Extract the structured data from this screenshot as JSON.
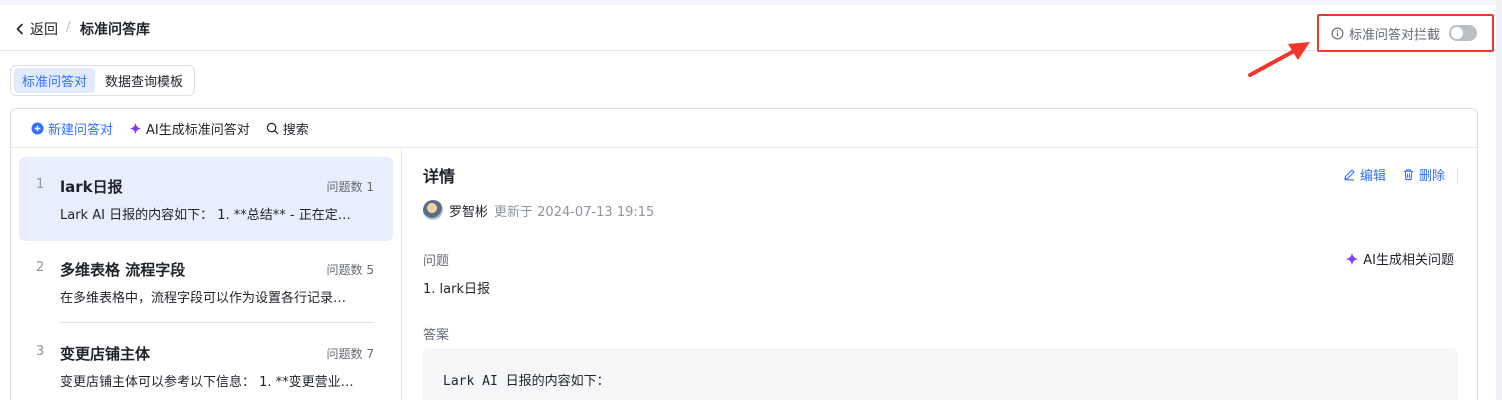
{
  "header": {
    "back_label": "返回",
    "separator": "/",
    "breadcrumb_title": "标准问答库",
    "intercept_label": "标准问答对拦截",
    "intercept_enabled": false
  },
  "tabs": [
    {
      "label": "标准问答对",
      "active": true
    },
    {
      "label": "数据查询模板",
      "active": false
    }
  ],
  "toolbar": {
    "new_label": "新建问答对",
    "ai_generate_label": "AI生成标准问答对",
    "search_label": "搜索"
  },
  "list": [
    {
      "index": "1",
      "title": "lark日报",
      "count": "问题数 1",
      "desc": "Lark AI 日报的内容如下： 1. **总结** - 正在定…"
    },
    {
      "index": "2",
      "title": "多维表格 流程字段",
      "count": "问题数 5",
      "desc": "在多维表格中，流程字段可以作为设置各行记录…"
    },
    {
      "index": "3",
      "title": "变更店铺主体",
      "count": "问题数 7",
      "desc": "变更店铺主体可以参考以下信息： 1. **变更营业…"
    }
  ],
  "detail": {
    "title": "详情",
    "edit_label": "编辑",
    "delete_label": "删除",
    "author": "罗智彬",
    "updated": "更新于 2024-07-13 19:15",
    "question_label": "问题",
    "ai_related_label": "AI生成相关问题",
    "question_text": "1. lark日报",
    "answer_label": "答案",
    "answer_text": "Lark AI 日报的内容如下："
  },
  "colors": {
    "accent": "#3370ff",
    "highlight_border": "#f0372a",
    "selected_bg": "#e8eefc",
    "ai_sparkle": "#7f3bf5"
  }
}
